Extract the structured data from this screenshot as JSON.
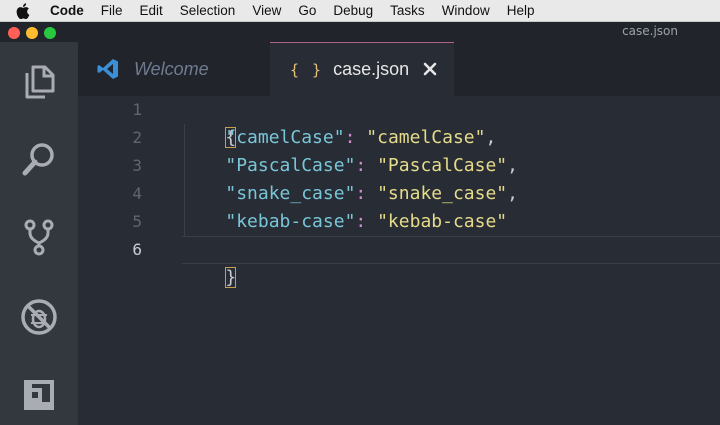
{
  "menubar": {
    "apple_icon": "apple-logo-icon",
    "items": [
      "Code",
      "File",
      "Edit",
      "Selection",
      "View",
      "Go",
      "Debug",
      "Tasks",
      "Window",
      "Help"
    ]
  },
  "titlebar": {
    "title": "case.json"
  },
  "activitybar": {
    "icons": [
      "files-icon",
      "search-icon",
      "source-control-icon",
      "debug-icon",
      "extensions-icon"
    ]
  },
  "tabs": [
    {
      "label": "Welcome",
      "icon": "vscode-logo-icon",
      "active": false
    },
    {
      "label": "case.json",
      "icon": "json-braces-icon",
      "active": true,
      "close_label": "✕"
    }
  ],
  "json_icon_text": "{ }",
  "editor": {
    "line_numbers": [
      "1",
      "2",
      "3",
      "4",
      "5",
      "6"
    ],
    "current_line": 6,
    "lines": [
      {
        "open": "{"
      },
      {
        "key": "\"camelCase\"",
        "colon": ":",
        "value": "\"camelCase\"",
        "comma": ","
      },
      {
        "key": "\"PascalCase\"",
        "colon": ":",
        "value": "\"PascalCase\"",
        "comma": ","
      },
      {
        "key": "\"snake_case\"",
        "colon": ":",
        "value": "\"snake_case\"",
        "comma": ","
      },
      {
        "key": "\"kebab-case\"",
        "colon": ":",
        "value": "\"kebab-case\"",
        "comma": ""
      },
      {
        "close": "}"
      }
    ]
  },
  "colors": {
    "editor_bg": "#282c34",
    "activity_bg": "#33373e",
    "key": "#79c6d9",
    "string": "#e6db8a",
    "colon": "#d58bd6"
  }
}
